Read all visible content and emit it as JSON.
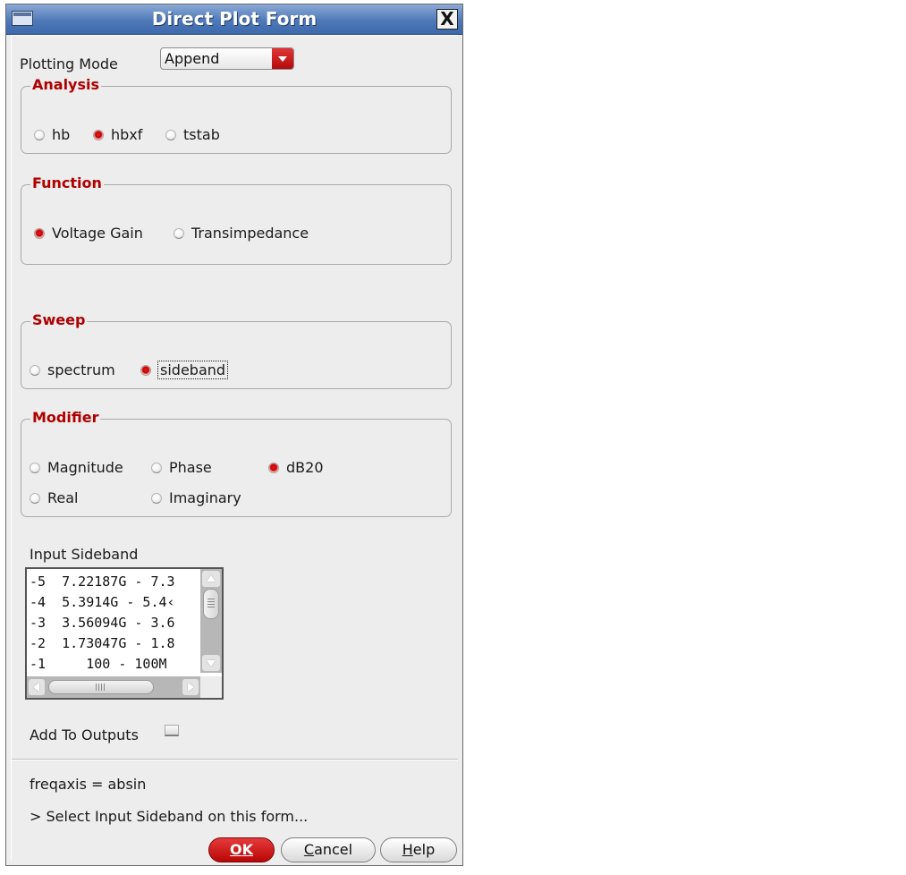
{
  "window": {
    "title": "Direct Plot Form",
    "close_glyph": "X"
  },
  "plotting_mode": {
    "label": "Plotting Mode",
    "selected": "Append"
  },
  "analysis": {
    "title": "Analysis",
    "options": [
      "hb",
      "hbxf",
      "tstab"
    ],
    "selected": "hbxf"
  },
  "function": {
    "title": "Function",
    "options": [
      "Voltage Gain",
      "Transimpedance"
    ],
    "selected": "Voltage Gain"
  },
  "sweep": {
    "title": "Sweep",
    "options": [
      "spectrum",
      "sideband"
    ],
    "selected": "sideband"
  },
  "modifier": {
    "title": "Modifier",
    "options": [
      "Magnitude",
      "Phase",
      "dB20",
      "Real",
      "Imaginary"
    ],
    "selected": "dB20"
  },
  "input_sideband": {
    "label": "Input Sideband",
    "rows": [
      "-5  7.22187G - 7.3",
      "-4  5.3914G - 5.4‹",
      "-3  3.56094G - 3.6",
      "-2  1.73047G - 1.8",
      "-1     100 - 100M"
    ]
  },
  "add_to_outputs": {
    "label": "Add To Outputs",
    "checked": false
  },
  "status": {
    "freqaxis": "freqaxis = absin",
    "prompt": "> Select Input Sideband on this form..."
  },
  "buttons": {
    "ok": "OK",
    "cancel": "Cancel",
    "help": "Help"
  },
  "colors": {
    "accent_red": "#c00000",
    "titlebar_blue": "#4f79b8",
    "panel": "#ededed"
  }
}
